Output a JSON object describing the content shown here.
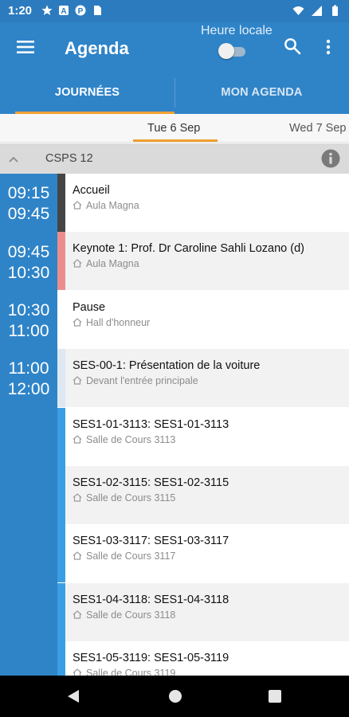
{
  "status_bar": {
    "time": "1:20",
    "icons_left": [
      "star-icon",
      "a-icon",
      "p-icon",
      "sim-card-icon"
    ],
    "icons_right": [
      "wifi-icon",
      "signal-icon",
      "battery-icon"
    ]
  },
  "app_bar": {
    "title": "Agenda",
    "timezone_label": "Heure locale",
    "timezone_toggle_on": false,
    "icons": [
      "menu-icon",
      "search-icon",
      "more-vert-icon"
    ]
  },
  "tabs": [
    {
      "label": "JOURNÉES",
      "selected": true
    },
    {
      "label": "MON AGENDA",
      "selected": false
    }
  ],
  "dates": [
    {
      "label": "Tue 6 Sep",
      "selected": true
    },
    {
      "label": "Wed 7 Sep",
      "selected": false
    }
  ],
  "group": {
    "label": "CSPS 12",
    "expanded": true
  },
  "time_slots": [
    {
      "start": "09:15",
      "end": "09:45"
    },
    {
      "start": "09:45",
      "end": "10:30"
    },
    {
      "start": "10:30",
      "end": "11:00"
    },
    {
      "start": "11:00",
      "end": "12:00"
    }
  ],
  "events": [
    {
      "title": "Accueil",
      "place": "Aula Magna",
      "color": "#454545",
      "bg": "#ffffff"
    },
    {
      "title": "Keynote 1: Prof. Dr Caroline Sahli Lozano (d)",
      "place": "Aula Magna",
      "color": "#ec8d8d",
      "bg": "#f2f2f2"
    },
    {
      "title": "Pause",
      "place": "Hall d'honneur",
      "color": "#ffffff",
      "bg": "#ffffff"
    },
    {
      "title": "SES-00-1: Présentation de la voiture",
      "place": "Devant l'entrée principale",
      "color": "#dde8f3",
      "bg": "#f2f2f2"
    },
    {
      "title": "SES1-01-3113: SES1-01-3113",
      "place": "Salle de Cours 3113",
      "color": "#3a9ee4",
      "bg": "#ffffff"
    },
    {
      "title": "SES1-02-3115: SES1-02-3115",
      "place": "Salle de Cours 3115",
      "color": "#3a9ee4",
      "bg": "#f2f2f2"
    },
    {
      "title": "SES1-03-3117: SES1-03-3117",
      "place": "Salle de Cours 3117",
      "color": "#3a9ee4",
      "bg": "#ffffff"
    },
    {
      "title": "SES1-04-3118: SES1-04-3118",
      "place": "Salle de Cours 3118",
      "color": "#3a9ee4",
      "bg": "#f2f2f2"
    },
    {
      "title": "SES1-05-3119: SES1-05-3119",
      "place": "Salle de Cours 3119",
      "color": "#3a9ee4",
      "bg": "#ffffff"
    }
  ],
  "colors": {
    "primary": "#2f84c8",
    "accent": "#f0a030",
    "status_bar": "#2c7bbf"
  },
  "nav_bar": {
    "icons": [
      "back-icon",
      "home-icon",
      "recent-apps-icon"
    ]
  }
}
